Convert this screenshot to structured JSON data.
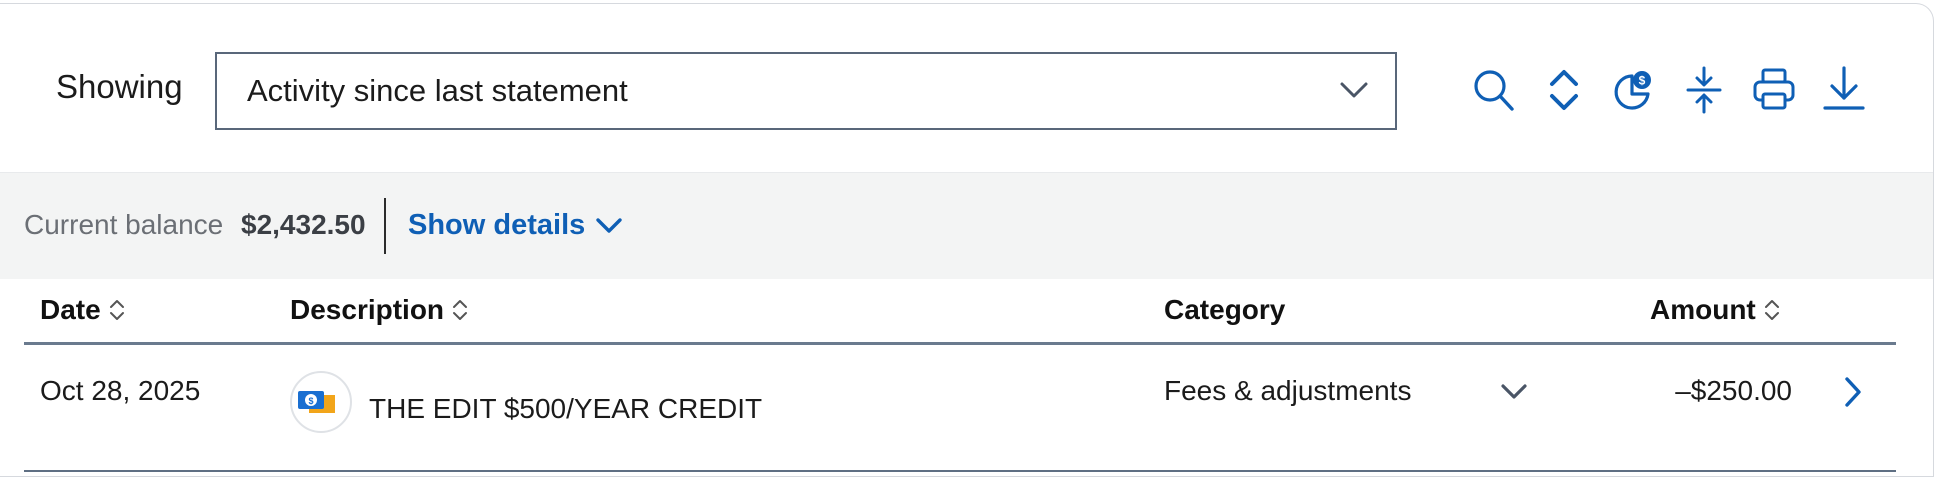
{
  "filter": {
    "label": "Showing",
    "selected": "Activity since last statement"
  },
  "toolbar": {
    "icons": [
      "search-icon",
      "expand-collapse-icon",
      "spending-chart-icon",
      "condense-icon",
      "print-icon",
      "download-icon"
    ]
  },
  "balance": {
    "label": "Current balance",
    "value": "$2,432.50",
    "details_label": "Show details"
  },
  "table": {
    "columns": {
      "date": "Date",
      "description": "Description",
      "category": "Category",
      "amount": "Amount"
    },
    "rows": [
      {
        "date": "Oct 28, 2025",
        "description": "THE EDIT $500/YEAR CREDIT",
        "category": "Fees & adjustments",
        "amount": "–$250.00"
      }
    ]
  },
  "colors": {
    "accent": "#0f5fb5",
    "balance_bg": "#f3f4f4",
    "border": "#6a7a8e"
  }
}
